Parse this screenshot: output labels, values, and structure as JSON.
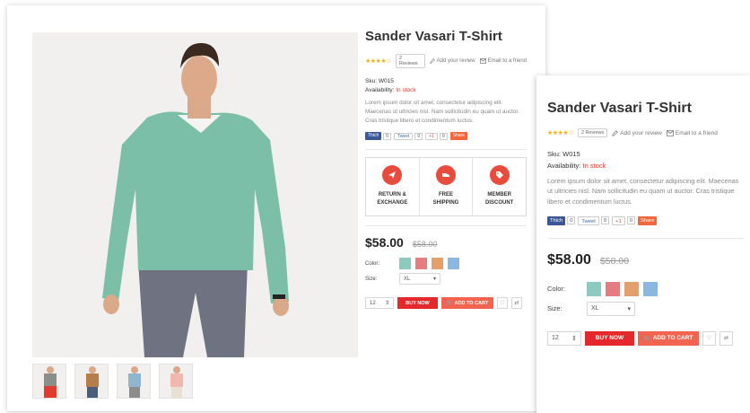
{
  "product": {
    "title": "Sander Vasari T-Shirt",
    "stars": "★★★★☆",
    "reviews": "2 Reviews",
    "add_review": "Add your review",
    "email_friend": "Email to a friend",
    "sku_label": "Sku:",
    "sku_value": "W015",
    "availability_label": "Availability:",
    "availability_value": "In stock",
    "description": "Lorem ipsum dolor sit amet, consectetur adipiscing elit. Maecenas ut ultricies nisl. Nam sollicitudin eu quam ut auctor. Cras tristique libero et condimentum luctus.",
    "price": "$58.00",
    "old_price": "$58.00",
    "color_label": "Color:",
    "size_label": "Size:",
    "size_value": "XL",
    "qty_value": "12",
    "buy_now": "BUY NOW",
    "add_to_cart": "ADD TO CART",
    "swatches": [
      "#8cc9be",
      "#e57c80",
      "#e3a06d",
      "#8ab8e0"
    ]
  },
  "social": {
    "facebook": "Thich",
    "facebook_count": "0",
    "tweet": "Tweet",
    "tweet_count": "0",
    "gplus": "+1",
    "gplus_count": "0",
    "share": "Share"
  },
  "features": [
    {
      "line1": "RETURN &",
      "line2": "EXCHANGE",
      "icon": "plane-icon"
    },
    {
      "line1": "FREE",
      "line2": "SHIPPING",
      "icon": "truck-icon"
    },
    {
      "line1": "MEMBER",
      "line2": "DISCOUNT",
      "icon": "tag-icon"
    }
  ],
  "gallery": {
    "thumb_colors": [
      "#e23a2e",
      "#b57d49",
      "#8fb5cf",
      "#f2b8b0"
    ]
  }
}
